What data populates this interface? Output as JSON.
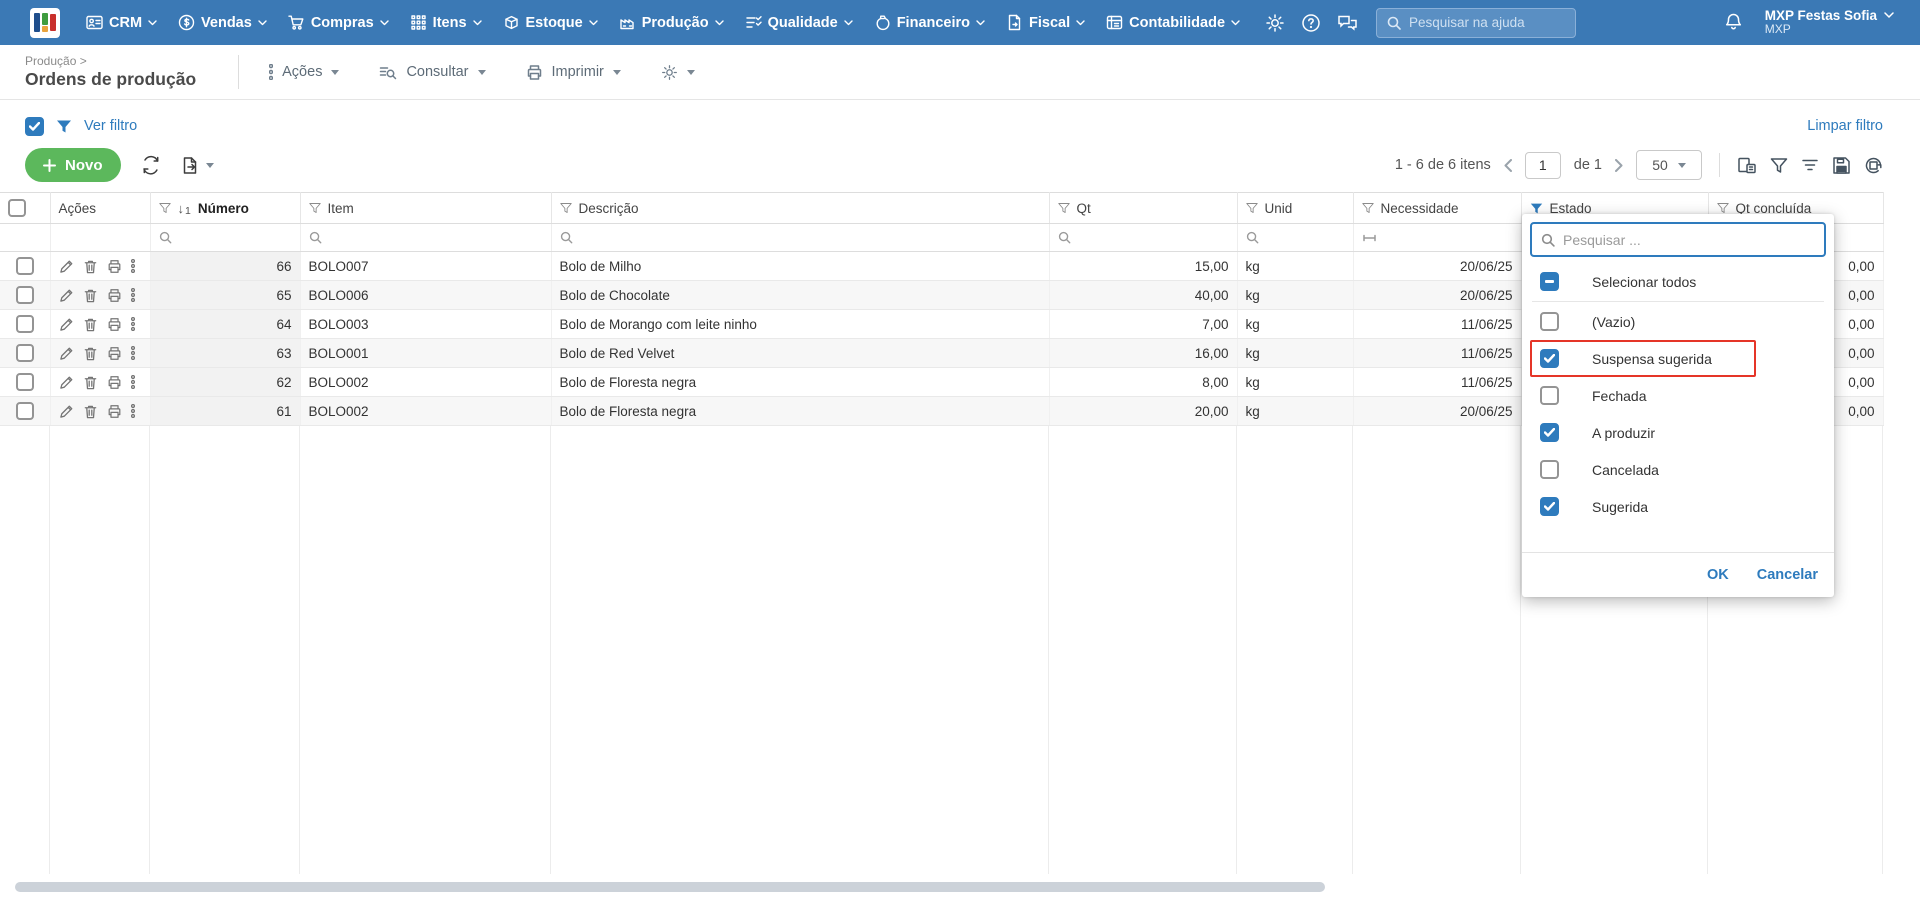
{
  "navbar": {
    "menus": [
      {
        "label": "CRM",
        "icon": "crm-icon"
      },
      {
        "label": "Vendas",
        "icon": "sales-icon"
      },
      {
        "label": "Compras",
        "icon": "cart-icon"
      },
      {
        "label": "Itens",
        "icon": "items-grid-icon"
      },
      {
        "label": "Estoque",
        "icon": "package-icon"
      },
      {
        "label": "Produção",
        "icon": "factory-icon"
      },
      {
        "label": "Qualidade",
        "icon": "checklist-icon"
      },
      {
        "label": "Financeiro",
        "icon": "money-bag-icon"
      },
      {
        "label": "Fiscal",
        "icon": "document-icon"
      },
      {
        "label": "Contabilidade",
        "icon": "ledger-icon"
      }
    ],
    "search_placeholder": "Pesquisar na ajuda",
    "user": {
      "name": "MXP Festas Sofia",
      "company": "MXP"
    }
  },
  "breadcrumb": {
    "parent": "Produção >",
    "title": "Ordens de produção"
  },
  "page_actions": {
    "acoes": "Ações",
    "consultar": "Consultar",
    "imprimir": "Imprimir"
  },
  "filter_bar": {
    "ver_filtro": "Ver filtro",
    "limpar_filtro": "Limpar filtro"
  },
  "toolbar": {
    "novo_label": "Novo",
    "pagination": {
      "range": "1 - 6 de 6 itens",
      "page_value": "1",
      "of_label": "de 1",
      "page_size": "50"
    }
  },
  "grid": {
    "headers": {
      "acoes": "Ações",
      "numero": "Número",
      "item": "Item",
      "descricao": "Descrição",
      "qt": "Qt",
      "unid": "Unid",
      "necessidade": "Necessidade",
      "estado": "Estado",
      "qt_concluida": "Qt concluída"
    },
    "sort": {
      "column": "Número",
      "direction": "asc",
      "order": "1"
    },
    "rows": [
      {
        "numero": "66",
        "item": "BOLO007",
        "descricao": "Bolo de Milho",
        "qt": "15,00",
        "unid": "kg",
        "necessidade": "20/06/25",
        "qt_concluida": "0,00"
      },
      {
        "numero": "65",
        "item": "BOLO006",
        "descricao": "Bolo de Chocolate",
        "qt": "40,00",
        "unid": "kg",
        "necessidade": "20/06/25",
        "qt_concluida": "0,00"
      },
      {
        "numero": "64",
        "item": "BOLO003",
        "descricao": "Bolo de Morango com leite ninho",
        "qt": "7,00",
        "unid": "kg",
        "necessidade": "11/06/25",
        "qt_concluida": "0,00"
      },
      {
        "numero": "63",
        "item": "BOLO001",
        "descricao": "Bolo de Red Velvet",
        "qt": "16,00",
        "unid": "kg",
        "necessidade": "11/06/25",
        "qt_concluida": "0,00"
      },
      {
        "numero": "62",
        "item": "BOLO002",
        "descricao": "Bolo de Floresta negra",
        "qt": "8,00",
        "unid": "kg",
        "necessidade": "11/06/25",
        "qt_concluida": "0,00"
      },
      {
        "numero": "61",
        "item": "BOLO002",
        "descricao": "Bolo de Floresta negra",
        "qt": "20,00",
        "unid": "kg",
        "necessidade": "20/06/25",
        "qt_concluida": "0,00"
      }
    ]
  },
  "estado_filter": {
    "search_placeholder": "Pesquisar ...",
    "options": [
      {
        "label": "Selecionar todos",
        "state": "indeterminate",
        "highlighted": false
      },
      {
        "label": "(Vazio)",
        "state": "unchecked",
        "highlighted": false
      },
      {
        "label": "Suspensa sugerida",
        "state": "checked",
        "highlighted": true
      },
      {
        "label": "Fechada",
        "state": "unchecked",
        "highlighted": false
      },
      {
        "label": "A produzir",
        "state": "checked",
        "highlighted": false
      },
      {
        "label": "Cancelada",
        "state": "unchecked",
        "highlighted": false
      },
      {
        "label": "Sugerida",
        "state": "checked",
        "highlighted": false
      }
    ],
    "ok_label": "OK",
    "cancel_label": "Cancelar"
  },
  "colors": {
    "navbar": "#3b79b5",
    "accent": "#2e7bbd",
    "novo_green": "#5cb85c",
    "highlight_red": "#e53528"
  }
}
